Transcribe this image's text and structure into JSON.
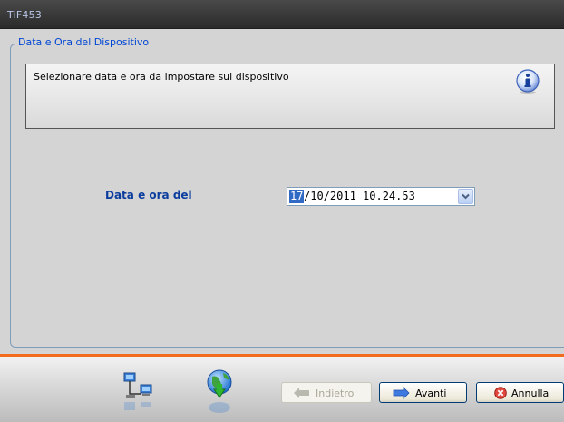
{
  "window": {
    "title": "TiF453"
  },
  "group": {
    "legend": "Data e Ora del Dispositivo"
  },
  "info": {
    "message": "Selezionare data e ora da impostare sul dispositivo",
    "icon": "info-icon"
  },
  "form": {
    "date_label": "Data e ora del",
    "date_value_selected": "17",
    "date_value_rest": "/10/2011 10.24.53"
  },
  "footer": {
    "back_label": "Indietro",
    "next_label": "Avanti",
    "cancel_label": "Annulla",
    "icons": [
      "network-icon",
      "globe-download-icon"
    ]
  },
  "colors": {
    "accent": "#f36b1c",
    "legend": "#0046d5",
    "label": "#0b3d9e",
    "selection": "#316ac5"
  }
}
